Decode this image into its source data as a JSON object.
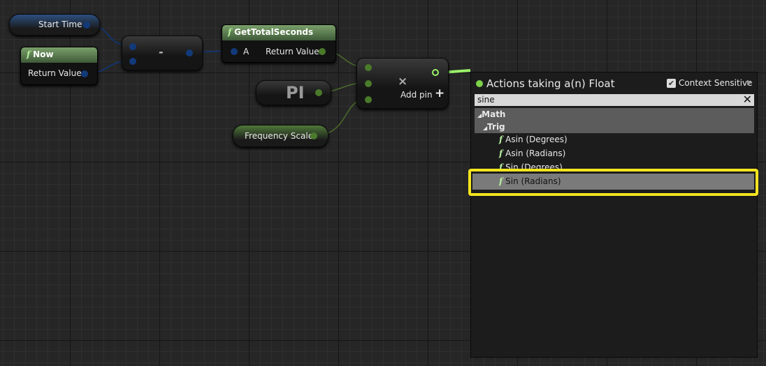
{
  "nodes": {
    "start_time": {
      "label": "Start Time"
    },
    "now": {
      "title": "Now",
      "return_label": "Return Value"
    },
    "subtract": {
      "symbol": "-"
    },
    "get_total_seconds": {
      "title": "GetTotalSeconds",
      "input_label": "A",
      "return_label": "Return Value"
    },
    "pi": {
      "label": "PI"
    },
    "frequency_scale": {
      "label": "Frequency Scale"
    },
    "multiply": {
      "symbol": "×",
      "add_pin_label": "Add pin",
      "add_pin_icon": "+"
    }
  },
  "menu": {
    "title": "Actions taking a(n) Float",
    "context_sensitive_label": "Context Sensitive",
    "context_sensitive_checked": true,
    "search_value": "sine",
    "categories": [
      "Math",
      "Trig"
    ],
    "items": [
      "Asin (Degrees)",
      "Asin (Radians)",
      "Sin (Degrees)",
      "Sin (Radians)"
    ],
    "selected": "Sin (Radians)",
    "highlight_color": "#f5e51f"
  },
  "colors": {
    "float_pin": "#7cd34a",
    "struct_pin": "#123a7a"
  }
}
